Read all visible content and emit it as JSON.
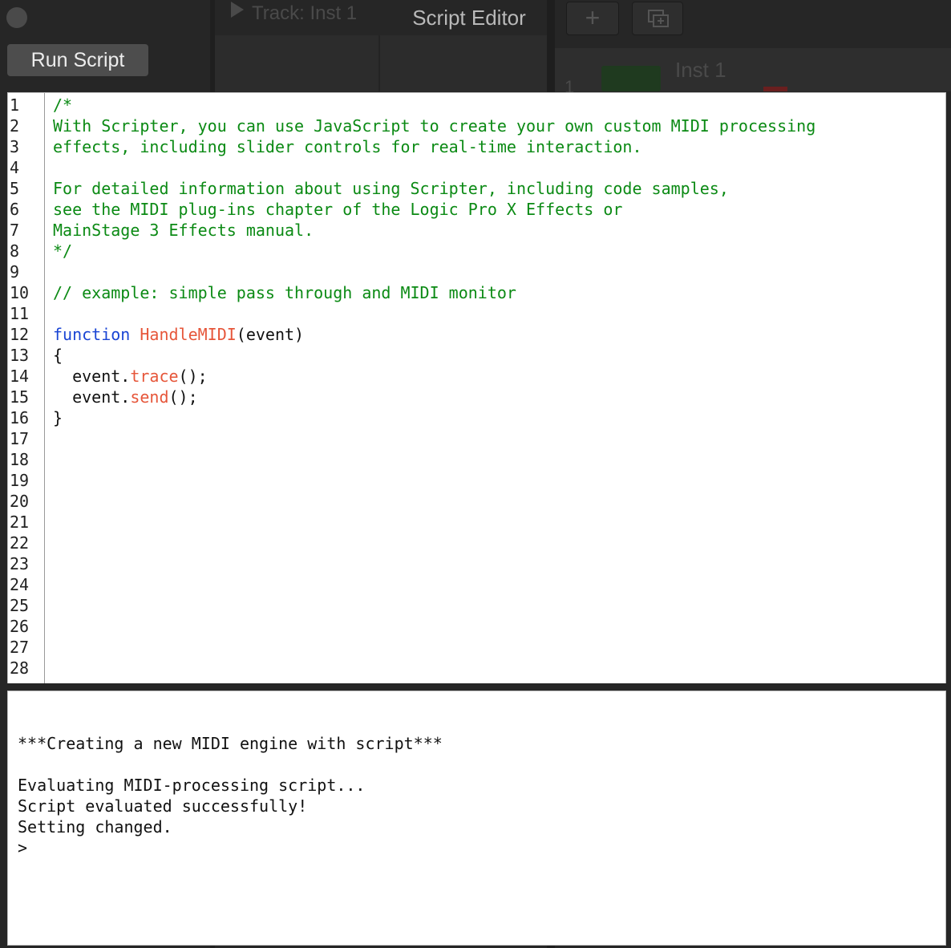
{
  "window": {
    "title": "Script Editor",
    "run_button_label": "Run Script"
  },
  "background": {
    "track_label": "Track:  Inst 1",
    "plus_label": "+",
    "inst_label": "Inst 1",
    "track_number": "1"
  },
  "editor": {
    "line_numbers": [
      "1",
      "2",
      "3",
      "4",
      "5",
      "6",
      "7",
      "8",
      "9",
      "10",
      "11",
      "12",
      "13",
      "14",
      "15",
      "16",
      "17",
      "18",
      "19",
      "20",
      "21",
      "22",
      "23",
      "24",
      "25",
      "26",
      "27",
      "28"
    ],
    "lines": [
      [
        {
          "t": "/*",
          "c": "comment"
        }
      ],
      [
        {
          "t": "With Scripter, you can use JavaScript to create your own custom MIDI processing",
          "c": "comment"
        }
      ],
      [
        {
          "t": "effects, including slider controls for real-time interaction.",
          "c": "comment"
        }
      ],
      [],
      [
        {
          "t": "For detailed information about using Scripter, including code samples,",
          "c": "comment"
        }
      ],
      [
        {
          "t": "see the MIDI plug-ins chapter of the Logic Pro X Effects or",
          "c": "comment"
        }
      ],
      [
        {
          "t": "MainStage 3 Effects manual.",
          "c": "comment"
        }
      ],
      [
        {
          "t": "*/",
          "c": "comment"
        }
      ],
      [],
      [
        {
          "t": "// example: simple pass through and MIDI monitor",
          "c": "comment"
        }
      ],
      [],
      [
        {
          "t": "function",
          "c": "keyword"
        },
        {
          "t": " ",
          "c": "plain"
        },
        {
          "t": "HandleMIDI",
          "c": "func"
        },
        {
          "t": "(event)",
          "c": "plain"
        }
      ],
      [
        {
          "t": "{",
          "c": "plain"
        }
      ],
      [
        {
          "t": "  event.",
          "c": "plain"
        },
        {
          "t": "trace",
          "c": "func"
        },
        {
          "t": "();",
          "c": "plain"
        }
      ],
      [
        {
          "t": "  event.",
          "c": "plain"
        },
        {
          "t": "send",
          "c": "func"
        },
        {
          "t": "();",
          "c": "plain"
        }
      ],
      [
        {
          "t": "}",
          "c": "plain"
        }
      ]
    ]
  },
  "console": {
    "lines": [
      "***Creating a new MIDI engine with script***",
      "",
      "Evaluating MIDI-processing script...",
      "Script evaluated successfully!",
      "Setting changed.",
      ">"
    ]
  },
  "colors": {
    "comment": "#0b8a14",
    "keyword": "#1a45d4",
    "function_name": "#e6563a"
  }
}
